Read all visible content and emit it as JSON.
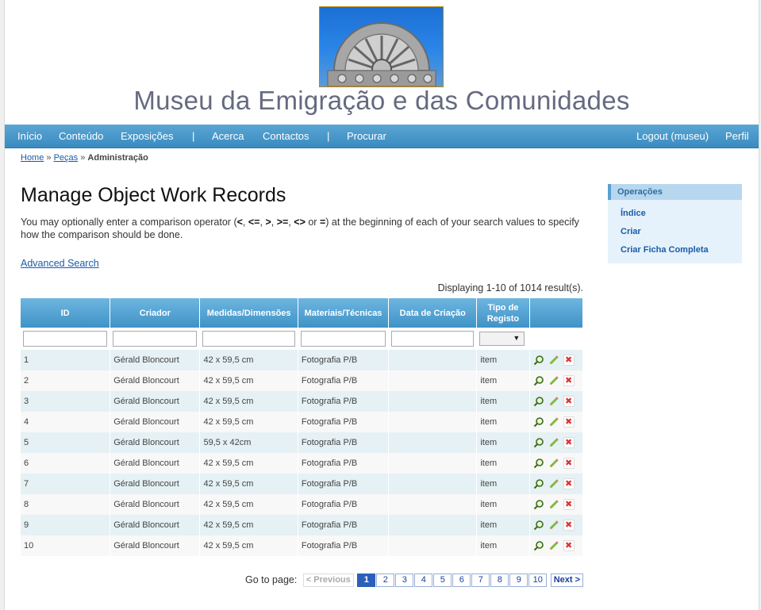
{
  "site": {
    "title": "Museu da Emigração e das Comunidades"
  },
  "nav": {
    "items": [
      "Início",
      "Conteúdo",
      "Exposições",
      "Acerca",
      "Contactos",
      "Procurar"
    ],
    "separator": "|",
    "logout": "Logout (museu)",
    "profile": "Perfil"
  },
  "breadcrumbs": {
    "home": "Home",
    "sep": "»",
    "pecas": "Peças",
    "current": "Administração"
  },
  "page": {
    "title": "Manage Object Work Records",
    "help_1": "You may optionally enter a comparison operator (",
    "op_lt": "<",
    "op_le": "<=",
    "op_gt": ">",
    "op_ge": ">=",
    "op_ne": "<>",
    "op_or": "or",
    "op_eq": "=",
    "help_2": ") at the beginning of each of your search values to specify how the comparison should be done.",
    "advanced_search": "Advanced Search",
    "summary": "Displaying 1-10 of 1014 result(s)."
  },
  "sidebar": {
    "header": "Operações",
    "items": [
      "Índice",
      "Criar",
      "Criar Ficha Completa"
    ]
  },
  "table": {
    "headers": [
      "ID",
      "Criador",
      "Medidas/Dimensões",
      "Materiais/Técnicas",
      "Data de Criação",
      "Tipo de Registo",
      ""
    ],
    "rows": [
      [
        "1",
        "Gérald Bloncourt",
        "42 x 59,5 cm",
        "Fotografia P/B",
        "",
        "item"
      ],
      [
        "2",
        "Gérald Bloncourt",
        "42 x 59,5 cm",
        "Fotografia P/B",
        "",
        "item"
      ],
      [
        "3",
        "Gérald Bloncourt",
        "42 x 59,5 cm",
        "Fotografia P/B",
        "",
        "item"
      ],
      [
        "4",
        "Gérald Bloncourt",
        "42 x 59,5 cm",
        "Fotografia P/B",
        "",
        "item"
      ],
      [
        "5",
        "Gérald Bloncourt",
        "59,5 x 42cm",
        "Fotografia P/B",
        "",
        "item"
      ],
      [
        "6",
        "Gérald Bloncourt",
        "42 x 59,5 cm",
        "Fotografia P/B",
        "",
        "item"
      ],
      [
        "7",
        "Gérald Bloncourt",
        "42 x 59,5 cm",
        "Fotografia P/B",
        "",
        "item"
      ],
      [
        "8",
        "Gérald Bloncourt",
        "42 x 59,5 cm",
        "Fotografia P/B",
        "",
        "item"
      ],
      [
        "9",
        "Gérald Bloncourt",
        "42 x 59,5 cm",
        "Fotografia P/B",
        "",
        "item"
      ],
      [
        "10",
        "Gérald Bloncourt",
        "42 x 59,5 cm",
        "Fotografia P/B",
        "",
        "item"
      ]
    ],
    "actions": [
      "view-icon",
      "edit-icon",
      "delete-icon"
    ]
  },
  "pager": {
    "label": "Go to page:",
    "prev": "< Previous",
    "pages": [
      "1",
      "2",
      "3",
      "4",
      "5",
      "6",
      "7",
      "8",
      "9",
      "10"
    ],
    "current": "1",
    "next": "Next >"
  },
  "colors": {
    "nav": "#3a8bc0",
    "header_cell": "#4f9fd0",
    "link": "#1a5ca8",
    "current_page": "#2c5fb8"
  }
}
